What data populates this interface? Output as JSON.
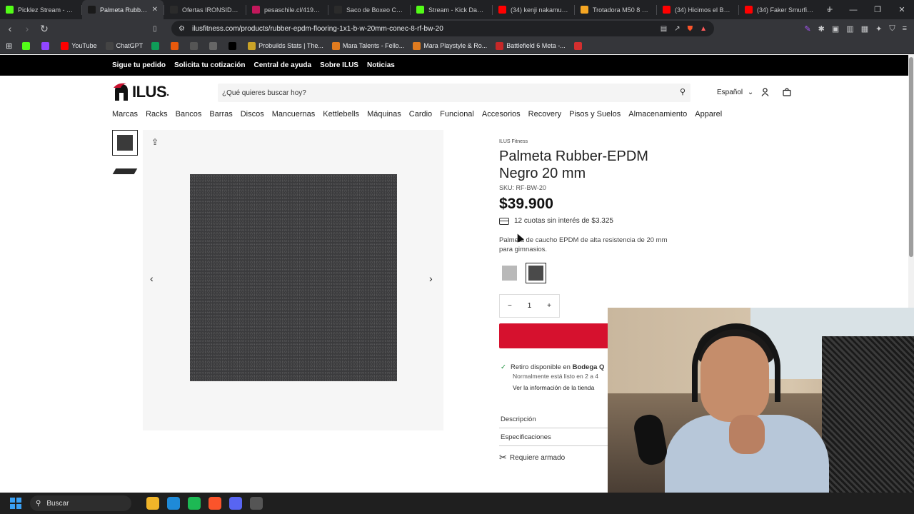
{
  "browser": {
    "tabs": [
      {
        "label": "Picklez Stream - Watch",
        "icon": "kick-icon",
        "color": "#53fc18"
      },
      {
        "label": "Palmeta Rubber-E",
        "icon": "ilus-icon",
        "color": "#1a1a1a",
        "active": true
      },
      {
        "label": "Ofertas IRONSIDE – Ir",
        "icon": "ironside-icon",
        "color": "#2b2b2b"
      },
      {
        "label": "pesaschile.cl/419-dest",
        "icon": "pesas-icon",
        "color": "#c2185b"
      },
      {
        "label": "Saco de Boxeo Cuero c",
        "icon": "ironside-icon",
        "color": "#2b2b2b"
      },
      {
        "label": "Stream - Kick Dashbo",
        "icon": "kick-icon",
        "color": "#53fc18"
      },
      {
        "label": "(34) kenji nakamura - Y",
        "icon": "youtube-icon",
        "color": "#ff0000"
      },
      {
        "label": "Trotadora M50 8 km/h",
        "icon": "star-icon",
        "color": "#f5a623"
      },
      {
        "label": "(34) Hicimos el BMW E",
        "icon": "youtube-icon",
        "color": "#ff0000"
      },
      {
        "label": "(34) Faker Smurfing in",
        "icon": "youtube-icon",
        "color": "#ff0000"
      }
    ],
    "url": "ilusfitness.com/products/rubber-epdm-flooring-1x1-b-w-20mm-conec-8-rf-bw-20",
    "bookmarks": [
      {
        "label": "",
        "icon": "kick-icon",
        "color": "#53fc18"
      },
      {
        "label": "",
        "icon": "twitch-icon",
        "color": "#9146ff"
      },
      {
        "label": "YouTube",
        "icon": "youtube-icon",
        "color": "#ff0000"
      },
      {
        "label": "ChatGPT",
        "icon": "chatgpt-icon",
        "color": "#444444"
      },
      {
        "label": "",
        "icon": "sheets-icon",
        "color": "#0f9d58"
      },
      {
        "label": "",
        "icon": "orange-icon",
        "color": "#e8590c"
      },
      {
        "label": "",
        "icon": "flickr-icon",
        "color": "#555555"
      },
      {
        "label": "",
        "icon": "helmet-icon",
        "color": "#666666"
      },
      {
        "label": "",
        "icon": "x-icon",
        "color": "#000000"
      },
      {
        "label": "Probuilds Stats | The...",
        "icon": "probuilds-icon",
        "color": "#c9a227"
      },
      {
        "label": "Mara Talents - Fello...",
        "icon": "mara-icon",
        "color": "#e07b1f"
      },
      {
        "label": "Mara Playstyle & Ro...",
        "icon": "mara-icon",
        "color": "#e07b1f"
      },
      {
        "label": "Battlefield 6 Meta -...",
        "icon": "battlefield-icon",
        "color": "#c62828"
      },
      {
        "label": "",
        "icon": "red-app-icon",
        "color": "#d32f2f"
      }
    ]
  },
  "store": {
    "topbar": [
      "Sigue tu pedido",
      "Solicita tu cotización",
      "Central de ayuda",
      "Sobre ILUS",
      "Noticias"
    ],
    "logo_text": "ILUS",
    "search_placeholder": "¿Qué quieres buscar hoy?",
    "language": "Español",
    "nav": [
      "Marcas",
      "Racks",
      "Bancos",
      "Barras",
      "Discos",
      "Mancuernas",
      "Kettlebells",
      "Máquinas",
      "Cardio",
      "Funcional",
      "Accesorios",
      "Recovery",
      "Pisos y Suelos",
      "Almacenamiento",
      "Apparel"
    ]
  },
  "product": {
    "brand": "ILUS Fitness",
    "title": "Palmeta Rubber-EPDM Negro 20 mm",
    "sku": "SKU: RF-BW-20",
    "price": "$39.900",
    "installments": "12 cuotas sin interés de $3.325",
    "description": "Palmeta de caucho EPDM de alta resistencia de 20 mm para gimnasios.",
    "swatches": [
      {
        "color": "#b9b9b9",
        "selected": false
      },
      {
        "color": "#4a4a4a",
        "selected": true
      }
    ],
    "quantity": "1",
    "pickup_prefix": "Retiro disponible en ",
    "pickup_store": "Bodega Q",
    "pickup_note": "Normalmente está listo en 2 a 4",
    "store_info_link": "Ver la información de la tienda",
    "accordion": [
      "Descripción",
      "Especificaciones"
    ],
    "assembly": "Requiere armado"
  },
  "taskbar": {
    "search_label": "Buscar",
    "apps": [
      {
        "icon": "file-explorer-icon",
        "color": "#f0b429"
      },
      {
        "icon": "edge-icon",
        "color": "#1f8ad8"
      },
      {
        "icon": "spotify-icon",
        "color": "#1db954"
      },
      {
        "icon": "brave-icon",
        "color": "#fb542b"
      },
      {
        "icon": "discord-icon",
        "color": "#5865f2"
      },
      {
        "icon": "steam-icon",
        "color": "#555555"
      }
    ]
  }
}
